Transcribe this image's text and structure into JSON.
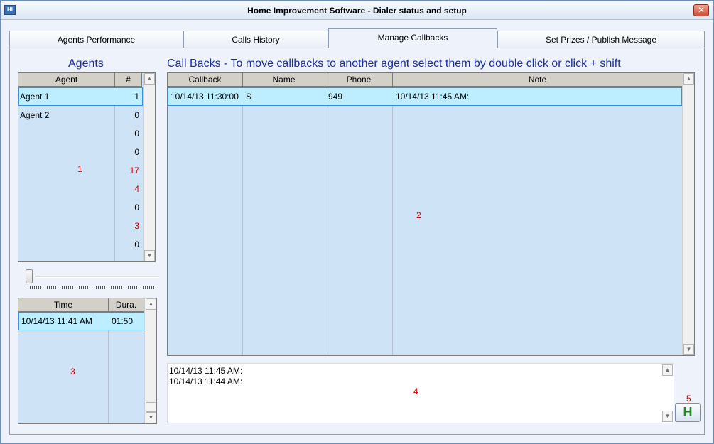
{
  "window": {
    "title": "Home Improvement Software - Dialer status and setup",
    "close_glyph": "✕"
  },
  "tabs": [
    {
      "label": "Agents Performance"
    },
    {
      "label": "Calls History"
    },
    {
      "label": "Manage Callbacks"
    },
    {
      "label": "Set Prizes / Publish Message"
    }
  ],
  "agents_panel": {
    "heading": "Agents",
    "columns": {
      "agent": "Agent",
      "count": "#"
    },
    "rows": [
      {
        "agent": "Agent 1",
        "count": "1",
        "color": "#000000"
      },
      {
        "agent": "Agent 2",
        "count": "0",
        "color": "#000000"
      },
      {
        "agent": "",
        "count": "0",
        "color": "#000000"
      },
      {
        "agent": "",
        "count": "0",
        "color": "#000000"
      },
      {
        "agent": "",
        "count": "17",
        "color": "#d00000"
      },
      {
        "agent": "",
        "count": "4",
        "color": "#d00000"
      },
      {
        "agent": "",
        "count": "0",
        "color": "#000000"
      },
      {
        "agent": "",
        "count": "3",
        "color": "#d00000"
      },
      {
        "agent": "",
        "count": "0",
        "color": "#000000"
      }
    ],
    "marker": "1"
  },
  "history_panel": {
    "columns": {
      "time": "Time",
      "duration": "Dura."
    },
    "rows": [
      {
        "time": "10/14/13 11:41 AM",
        "duration": "01:50"
      }
    ],
    "marker": "3"
  },
  "callbacks_panel": {
    "heading": "Call Backs - To move callbacks to another agent select them by double click or click + shift",
    "columns": {
      "callback": "Callback",
      "name": "Name",
      "phone": "Phone",
      "note": "Note"
    },
    "rows": [
      {
        "callback": "10/14/13 11:30:00",
        "name": "S",
        "phone": "949",
        "note": "10/14/13 11:45 AM:"
      }
    ],
    "marker": "2"
  },
  "notes_panel": {
    "lines": [
      "10/14/13 11:45 AM:",
      "10/14/13 11:44 AM:"
    ],
    "marker": "4"
  },
  "h_button": {
    "label": "H",
    "marker": "5"
  },
  "scroll_glyphs": {
    "up": "▲",
    "down": "▼"
  }
}
